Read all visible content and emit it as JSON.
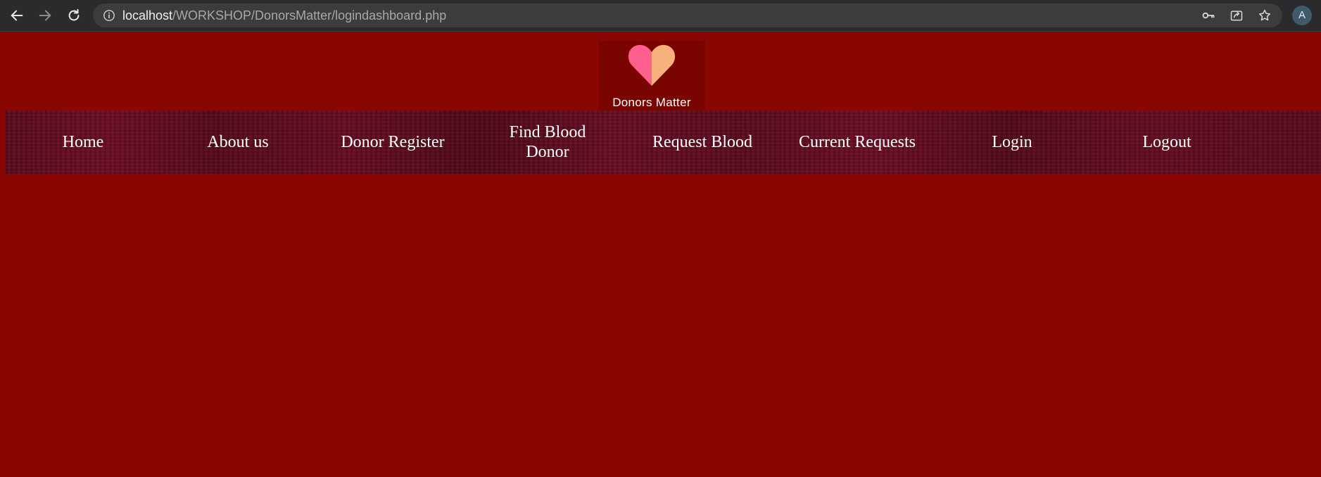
{
  "browser": {
    "url_host": "localhost",
    "url_path": "/WORKSHOP/DonorsMatter/logindashboard.php",
    "profile_initial": "A",
    "icons": [
      "back-arrow-icon",
      "forward-arrow-icon",
      "reload-icon",
      "info-icon",
      "key-icon",
      "share-icon",
      "star-icon"
    ]
  },
  "site": {
    "logo_text": "Donors Matter",
    "colors": {
      "page_background": "#8a0600",
      "nav_background": "#5a0a1c",
      "heart_left": "#ff5f8f",
      "heart_right": "#f6b27a",
      "text": "#ffffff"
    }
  },
  "nav": {
    "items": [
      {
        "label": "Home"
      },
      {
        "label": "About us"
      },
      {
        "label": "Donor Register"
      },
      {
        "label": "Find Blood Donor"
      },
      {
        "label": "Request Blood"
      },
      {
        "label": "Current Requests"
      },
      {
        "label": "Login"
      },
      {
        "label": "Logout"
      }
    ]
  }
}
